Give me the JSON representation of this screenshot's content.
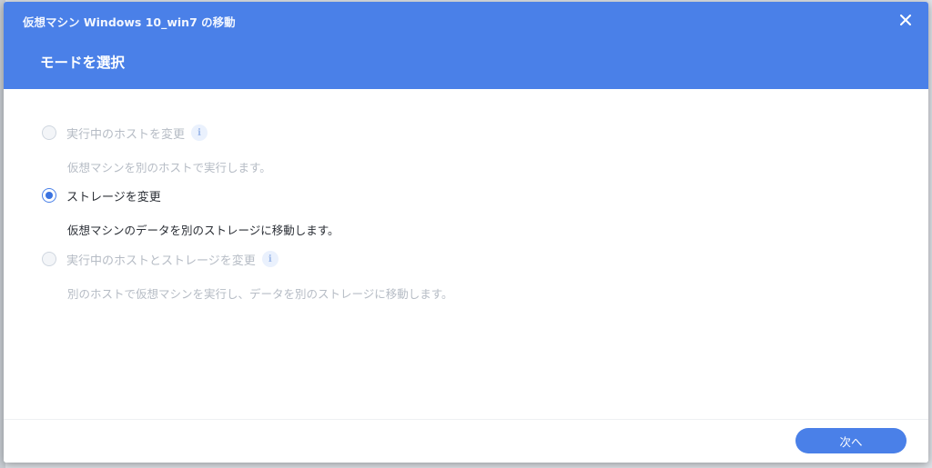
{
  "dialog": {
    "window_title": "仮想マシン Windows 10_win7 の移動",
    "step_title": "モードを選択",
    "close_icon": "close-icon"
  },
  "options": [
    {
      "label": "実行中のホストを変更",
      "description": "仮想マシンを別のホストで実行します。",
      "selected": false,
      "disabled": true,
      "has_info": true
    },
    {
      "label": "ストレージを変更",
      "description": "仮想マシンのデータを別のストレージに移動します。",
      "selected": true,
      "disabled": false,
      "has_info": false
    },
    {
      "label": "実行中のホストとストレージを変更",
      "description": "別のホストで仮想マシンを実行し、データを別のストレージに移動します。",
      "selected": false,
      "disabled": true,
      "has_info": true
    }
  ],
  "footer": {
    "next_label": "次へ"
  },
  "colors": {
    "accent": "#4a80e8",
    "disabled_text": "#b6bcc5",
    "text": "#2b2f36"
  }
}
